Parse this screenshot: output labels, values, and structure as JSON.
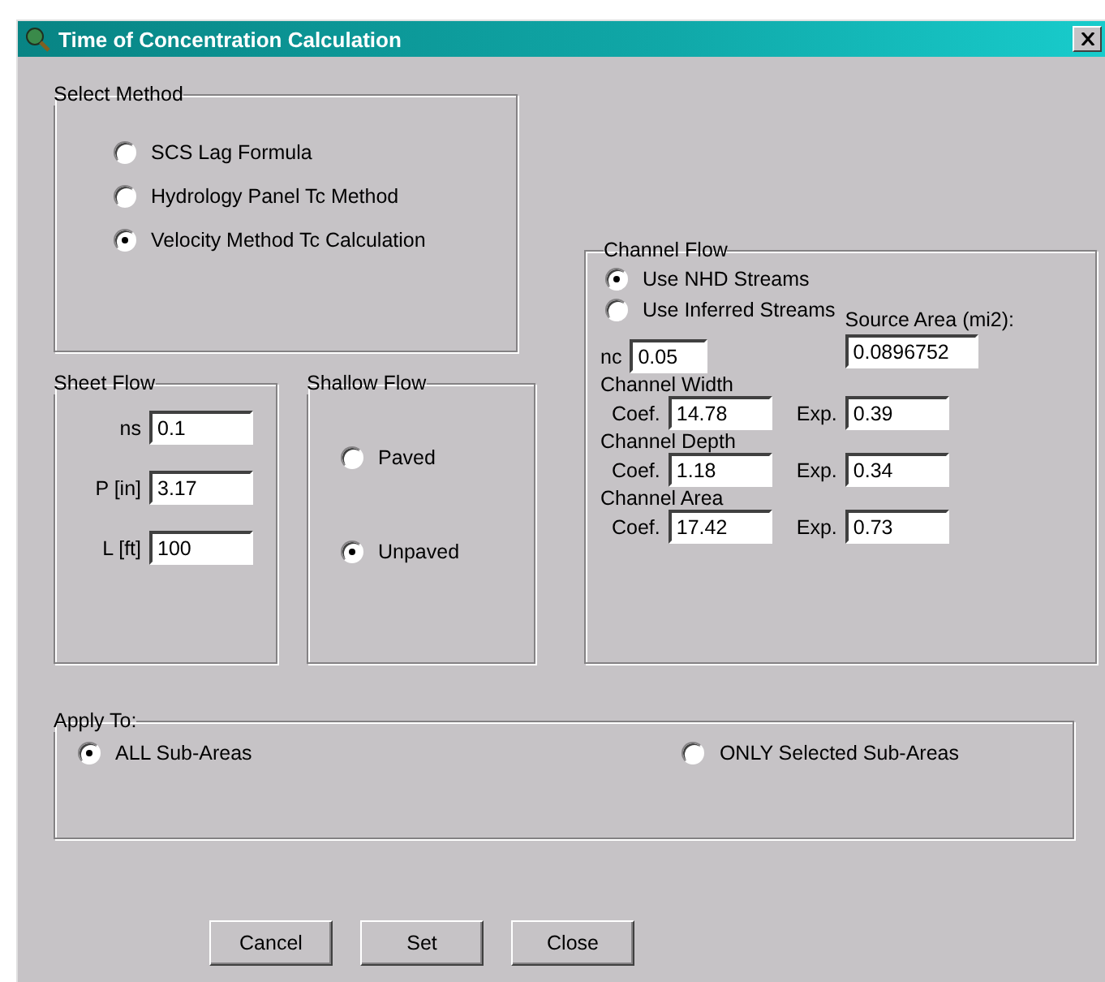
{
  "window": {
    "title": "Time of Concentration Calculation"
  },
  "select_method": {
    "title": "Select Method",
    "options": [
      {
        "label": "SCS Lag Formula",
        "selected": false
      },
      {
        "label": "Hydrology Panel Tc Method",
        "selected": false
      },
      {
        "label": "Velocity Method Tc Calculation",
        "selected": true
      }
    ]
  },
  "sheet_flow": {
    "title": "Sheet Flow",
    "fields": [
      {
        "label": "ns",
        "value": "0.1"
      },
      {
        "label": "P [in]",
        "value": "3.17"
      },
      {
        "label": "L [ft]",
        "value": "100"
      }
    ]
  },
  "shallow_flow": {
    "title": "Shallow Flow",
    "options": [
      {
        "label": "Paved",
        "selected": false
      },
      {
        "label": "Unpaved",
        "selected": true
      }
    ]
  },
  "channel_flow": {
    "title": "Channel Flow",
    "options": [
      {
        "label": "Use NHD Streams",
        "selected": true
      },
      {
        "label": "Use Inferred Streams",
        "selected": false
      }
    ],
    "nc": {
      "label": "nc",
      "value": "0.05"
    },
    "source_area": {
      "label": "Source Area (mi2):",
      "value": "0.0896752"
    },
    "groups": [
      {
        "title": "Channel Width",
        "coef_label": "Coef.",
        "coef": "14.78",
        "exp_label": "Exp.",
        "exp": "0.39"
      },
      {
        "title": "Channel Depth",
        "coef_label": "Coef.",
        "coef": "1.18",
        "exp_label": "Exp.",
        "exp": "0.34"
      },
      {
        "title": "Channel Area",
        "coef_label": "Coef.",
        "coef": "17.42",
        "exp_label": "Exp.",
        "exp": "0.73"
      }
    ]
  },
  "apply_to": {
    "title": "Apply To:",
    "options": [
      {
        "label": "ALL Sub-Areas",
        "selected": true
      },
      {
        "label": "ONLY Selected Sub-Areas",
        "selected": false
      }
    ]
  },
  "buttons": [
    "Cancel",
    "Set",
    "Close"
  ]
}
